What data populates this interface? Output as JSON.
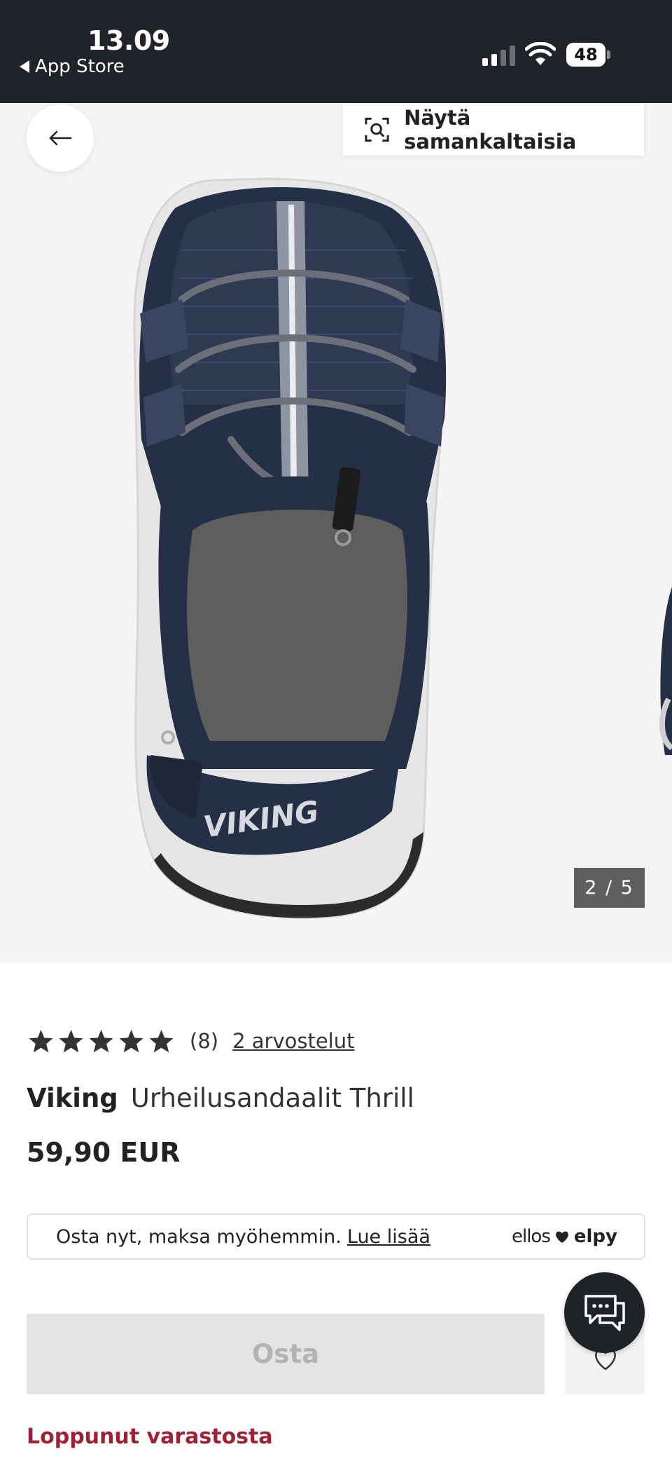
{
  "status_bar": {
    "time": "13.09",
    "back_app": "App Store",
    "battery": "48"
  },
  "gallery": {
    "similar_button_label": "Näytä samankaltaisia",
    "pager": "2 / 5",
    "product_image": "navy-sandal-top-view"
  },
  "product": {
    "rating_stars": 5,
    "rating_count": "(8)",
    "reviews_link": "2 arvostelut",
    "brand": "Viking",
    "name": "Urheilusandaalit Thrill",
    "price": "59,90 EUR"
  },
  "bnpl": {
    "text": "Osta nyt, maksa myöhemmin.",
    "link": "Lue lisää",
    "logo_left": "ellos",
    "logo_right": "elpy"
  },
  "actions": {
    "buy_label": "Osta",
    "stock_status": "Loppunut varastosta"
  },
  "colors": {
    "status_bar_bg": "#20232a",
    "gallery_bg": "#f4f4f4",
    "stock_red": "#9b2335",
    "buy_disabled_bg": "#e4e4e4"
  }
}
